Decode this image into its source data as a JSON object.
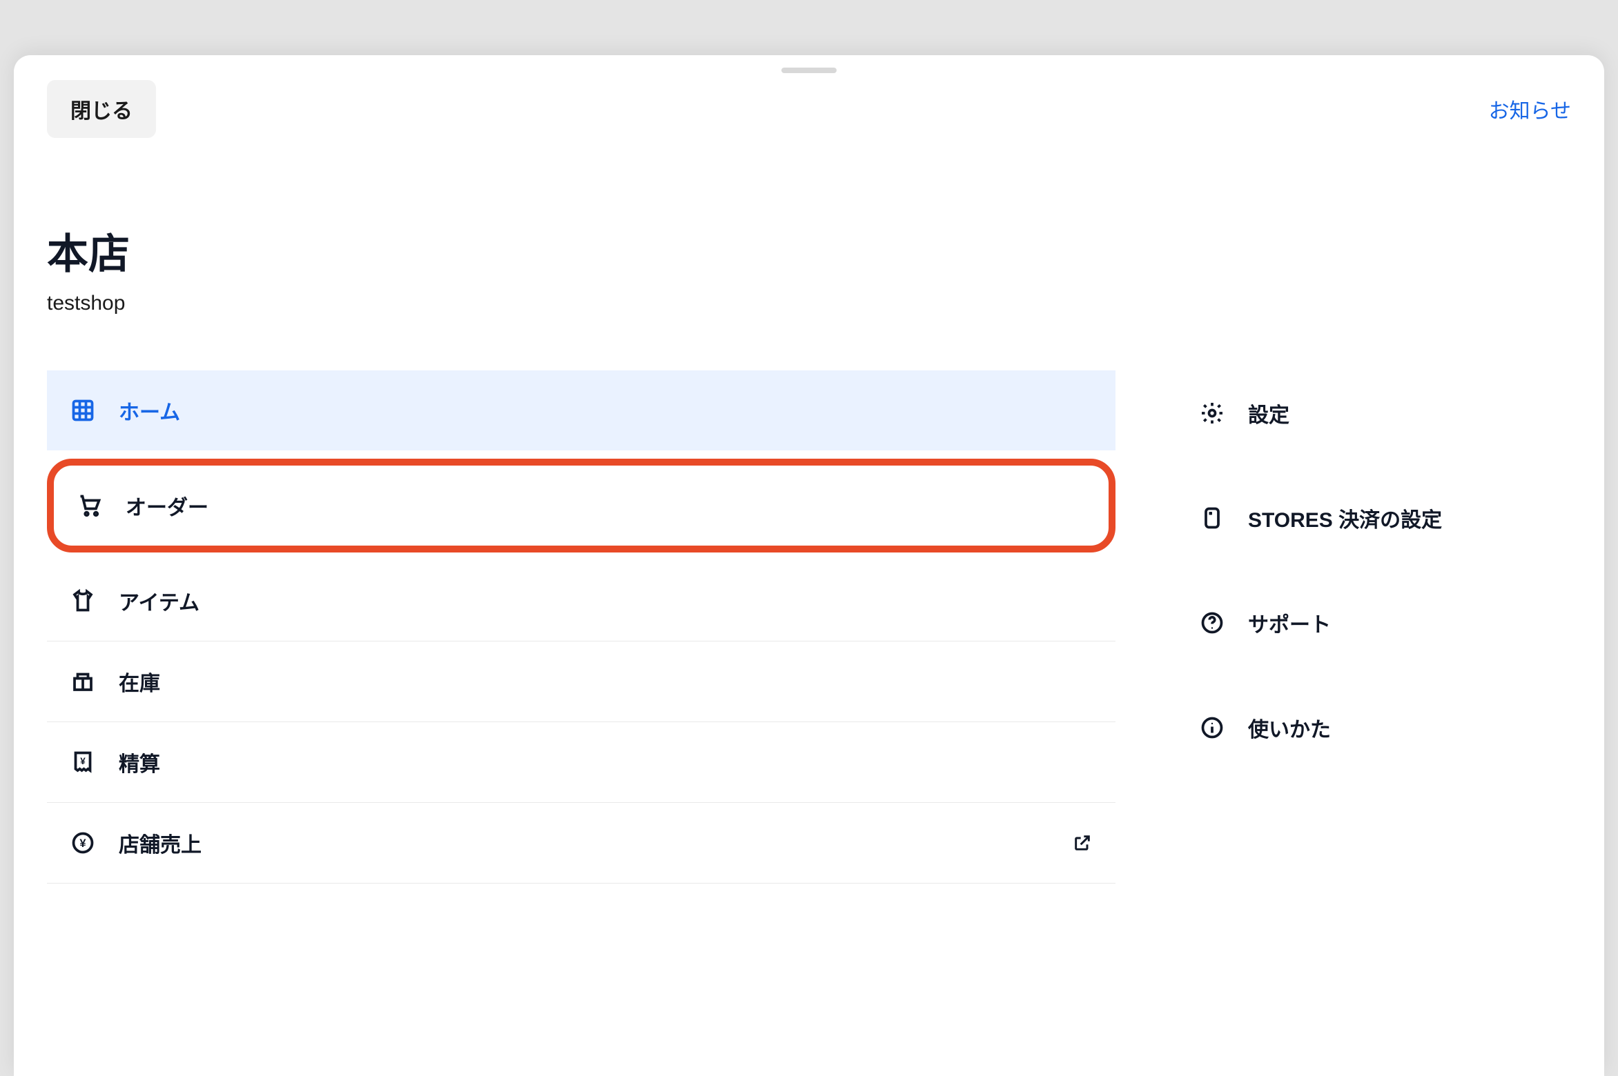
{
  "top_bar": {
    "close_label": "閉じる",
    "news_label": "お知らせ"
  },
  "store": {
    "name": "本店",
    "subtitle": "testshop"
  },
  "main_nav": {
    "items": [
      {
        "key": "home",
        "label": "ホーム",
        "active": true
      },
      {
        "key": "order",
        "label": "オーダー",
        "highlighted": true
      },
      {
        "key": "item",
        "label": "アイテム"
      },
      {
        "key": "stock",
        "label": "在庫"
      },
      {
        "key": "settlement",
        "label": "精算"
      },
      {
        "key": "sales",
        "label": "店舗売上",
        "external": true
      }
    ]
  },
  "side_nav": {
    "items": [
      {
        "key": "settings",
        "label": "設定"
      },
      {
        "key": "stores_payment",
        "label": "STORES 決済の設定"
      },
      {
        "key": "support",
        "label": "サポート"
      },
      {
        "key": "howto",
        "label": "使いかた"
      }
    ]
  }
}
